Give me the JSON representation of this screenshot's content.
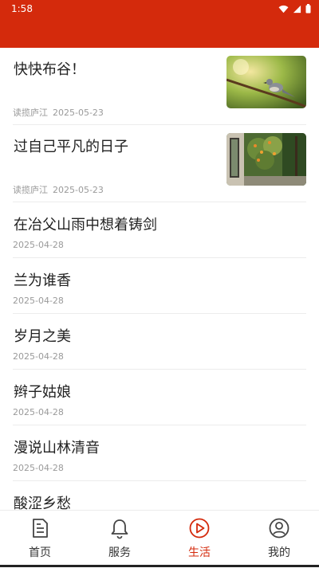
{
  "status_bar": {
    "time": "1:58"
  },
  "articles": [
    {
      "title": "快快布谷！",
      "source": "读揽庐江",
      "date": "2025-05-23",
      "thumbnail": "bird-on-branch"
    },
    {
      "title": "过自己平凡的日子",
      "source": "读揽庐江",
      "date": "2025-05-23",
      "thumbnail": "garden-courtyard"
    },
    {
      "title": "在冶父山雨中想着铸剑",
      "date": "2025-04-28"
    },
    {
      "title": "兰为谁香",
      "date": "2025-04-28"
    },
    {
      "title": "岁月之美",
      "date": "2025-04-28"
    },
    {
      "title": "辫子姑娘",
      "date": "2025-04-28"
    },
    {
      "title": "漫说山林清音",
      "date": "2025-04-28"
    },
    {
      "title": "酸涩乡愁",
      "date": ""
    }
  ],
  "bottom_nav": {
    "items": [
      {
        "label": "首页",
        "icon": "document-icon"
      },
      {
        "label": "服务",
        "icon": "bell-icon"
      },
      {
        "label": "生活",
        "icon": "play-circle-icon",
        "active": true
      },
      {
        "label": "我的",
        "icon": "user-icon"
      }
    ]
  },
  "colors": {
    "brand": "#d42a0c",
    "meta_text": "#9a9a9a"
  }
}
